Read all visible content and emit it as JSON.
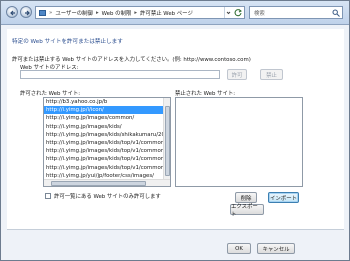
{
  "navbar": {
    "breadcrumb": [
      "ユーザーの制御",
      "Web の制限",
      "許可禁止 Web ページ"
    ],
    "search_placeholder": "検索"
  },
  "page": {
    "heading": "特定の Web サイトを許可または禁止します",
    "description": "許可または禁止する Web サイトのアドレスを入力してください。(例: http://www.contoso.com)",
    "address_label": "Web サイトのアドレス:",
    "address_value": "",
    "allow_button": "許可",
    "block_button": "禁止",
    "allowed_label": "許可された Web サイト:",
    "blocked_label": "禁止された Web サイト:",
    "allowed_sites": [
      "http://b3.yahoo.co.jp/b",
      "http://i.yimg.jp/i/icon/",
      "http://i.yimg.jp/images/common/",
      "http://i.yimg.jp/images/kids/",
      "http://i.yimg.jp/images/kids/shikakumaru/20",
      "http://i.yimg.jp/images/kids/top/v1/common",
      "http://i.yimg.jp/images/kids/top/v1/common",
      "http://i.yimg.jp/images/kids/top/v1/common",
      "http://i.yimg.jp/images/kids/top/v1/common",
      "http://i.yimg.jp/yui/jp/footer/css/images/"
    ],
    "selected_index": 1,
    "blocked_sites": [],
    "delete_button": "削除",
    "import_button": "インポート",
    "export_button": "エクスポート",
    "allow_only_checkbox": "許可一覧にある Web サイトのみ許可します"
  },
  "footer": {
    "ok_button": "OK",
    "cancel_button": "キャンセル"
  }
}
